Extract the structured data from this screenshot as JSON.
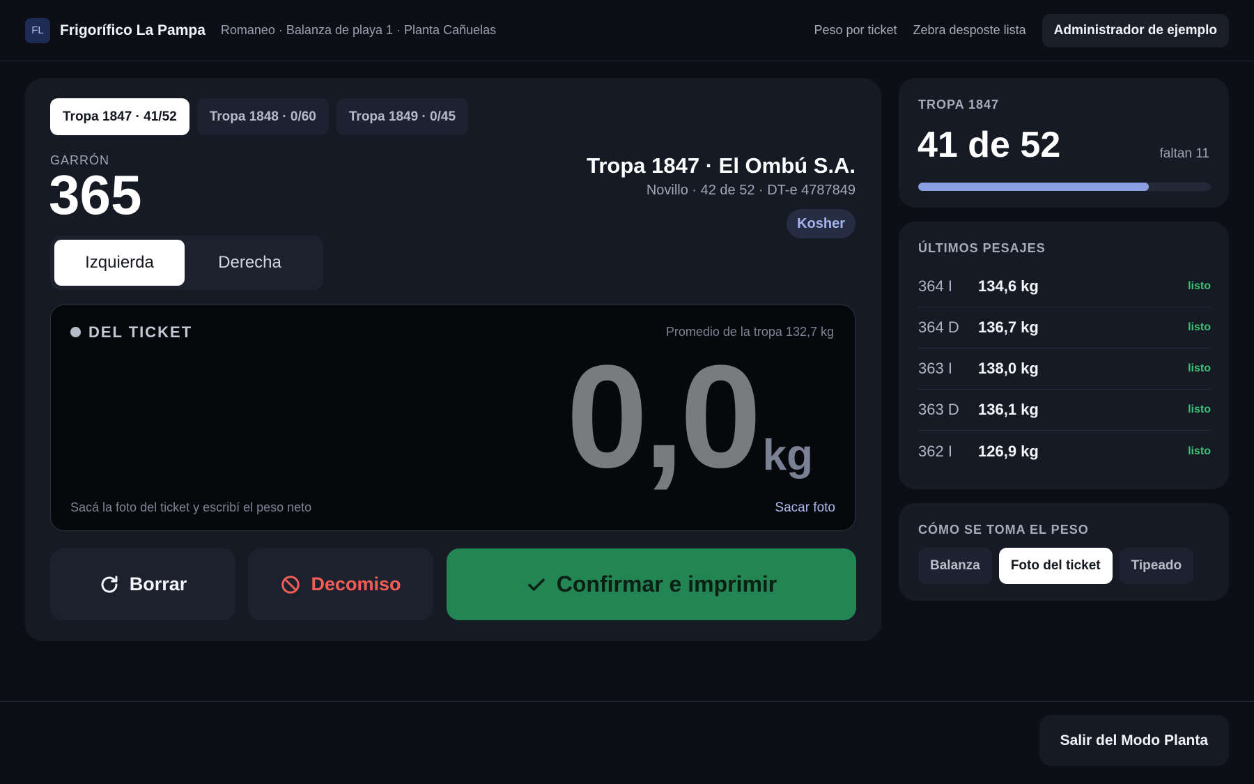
{
  "header": {
    "logo_text": "FL",
    "brand": "Frigorífico La Pampa",
    "context": "Romaneo · Balanza de playa 1 · Planta Cañuelas",
    "links": [
      "Peso por ticket",
      "Zebra desposte lista"
    ],
    "admin": "Administrador de ejemplo"
  },
  "tabs": [
    "Tropa 1847 · 41/52",
    "Tropa 1848 · 0/60",
    "Tropa 1849 · 0/45"
  ],
  "garron": {
    "label": "GARRÓN",
    "value": "365"
  },
  "sides": [
    "Izquierda",
    "Derecha"
  ],
  "tropa": {
    "title": "Tropa 1847 · El Ombú S.A.",
    "subtitle": "Novillo · 42 de 52 · DT-e 4787849",
    "badge": "Kosher"
  },
  "ticket": {
    "label": "DEL TICKET",
    "average": "Promedio de la tropa 132,7 kg",
    "weight": "0,0",
    "unit": "kg",
    "hint": "Sacá la foto del ticket y escribí el peso neto",
    "photo_link": "Sacar foto"
  },
  "actions": {
    "clear": "Borrar",
    "decomiso": "Decomiso",
    "confirm": "Confirmar e imprimir"
  },
  "progress": {
    "title": "TROPA 1847",
    "big": "41 de 52",
    "remaining": "faltan 11",
    "fraction": 0.788,
    "accent": "#8a9fe0"
  },
  "pesajes": {
    "title": "ÚLTIMOS PESAJES",
    "rows": [
      {
        "id": "364 I",
        "kg": "134,6 kg",
        "status": "listo"
      },
      {
        "id": "364 D",
        "kg": "136,7 kg",
        "status": "listo"
      },
      {
        "id": "363 I",
        "kg": "138,0 kg",
        "status": "listo"
      },
      {
        "id": "363 D",
        "kg": "136,1 kg",
        "status": "listo"
      },
      {
        "id": "362 I",
        "kg": "126,9 kg",
        "status": "listo"
      }
    ]
  },
  "metodo": {
    "title": "CÓMO SE TOMA EL PESO",
    "options": [
      "Balanza",
      "Foto del ticket",
      "Tipeado"
    ]
  },
  "footer": {
    "exit": "Salir del Modo Planta"
  },
  "colors": {
    "confirm": "#238553",
    "danger": "#f25e55",
    "ok": "#3fbf78"
  }
}
